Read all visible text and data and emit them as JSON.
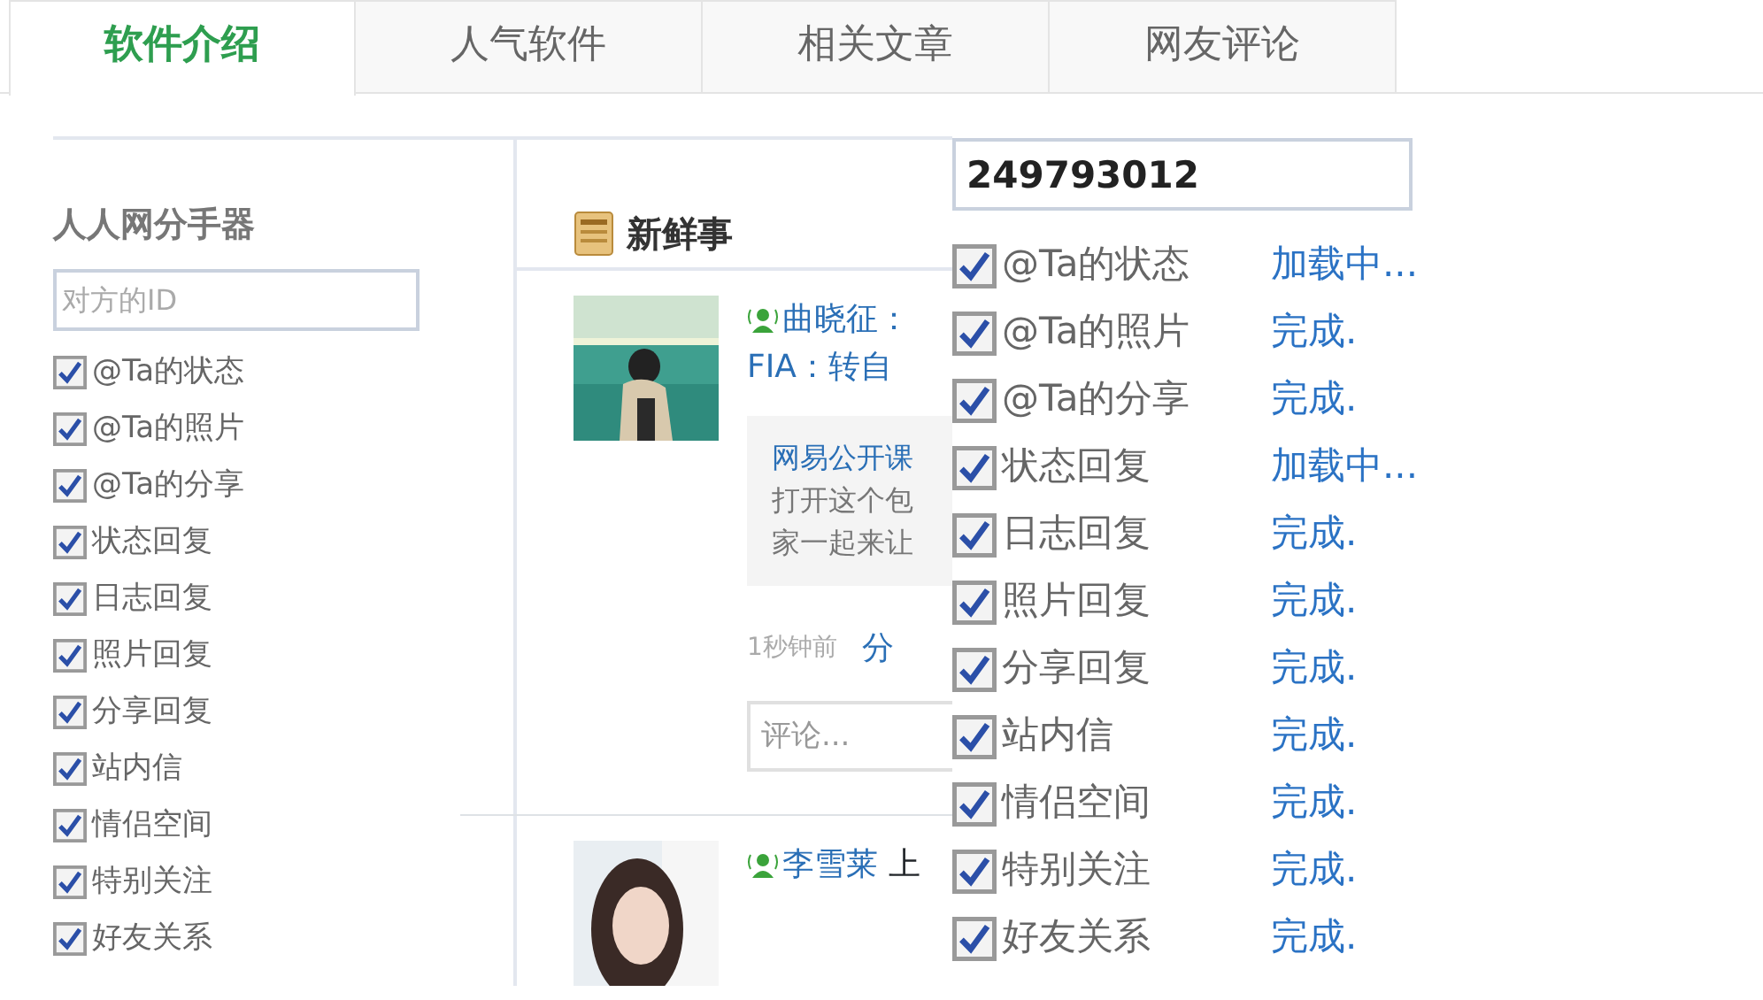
{
  "tabs": [
    {
      "label": "软件介绍",
      "selected": true
    },
    {
      "label": "人气软件",
      "selected": false
    },
    {
      "label": "相关文章",
      "selected": false
    },
    {
      "label": "网友评论",
      "selected": false
    }
  ],
  "left_panel": {
    "title": "人人网分手器",
    "id_field": {
      "placeholder": "对方的ID"
    },
    "options": [
      {
        "label": "@Ta的状态",
        "checked": true
      },
      {
        "label": "@Ta的照片",
        "checked": true
      },
      {
        "label": "@Ta的分享",
        "checked": true
      },
      {
        "label": "状态回复",
        "checked": true
      },
      {
        "label": "日志回复",
        "checked": true
      },
      {
        "label": "照片回复",
        "checked": true
      },
      {
        "label": "分享回复",
        "checked": true
      },
      {
        "label": "站内信",
        "checked": true
      },
      {
        "label": "情侣空间",
        "checked": true
      },
      {
        "label": "特别关注",
        "checked": true
      },
      {
        "label": "好友关系",
        "checked": true
      }
    ]
  },
  "feed": {
    "title": "新鲜事",
    "posts": [
      {
        "author": "曲晓征：",
        "text": "FIA：转自",
        "shared": {
          "title": "网易公开课",
          "lines": [
            "打开这个包",
            "家一起来让"
          ]
        },
        "time": "1秒钟前",
        "action": "分",
        "comment": {
          "placeholder": "评论..."
        }
      },
      {
        "author": "李雪莱",
        "text": "上"
      }
    ]
  },
  "tool_panel": {
    "id_field": {
      "value": "249793012"
    },
    "options": [
      {
        "label": "@Ta的状态",
        "checked": true,
        "status": "加载中..."
      },
      {
        "label": "@Ta的照片",
        "checked": true,
        "status": "完成."
      },
      {
        "label": "@Ta的分享",
        "checked": true,
        "status": "完成."
      },
      {
        "label": "状态回复",
        "checked": true,
        "status": "加载中..."
      },
      {
        "label": "日志回复",
        "checked": true,
        "status": "完成."
      },
      {
        "label": "照片回复",
        "checked": true,
        "status": "完成."
      },
      {
        "label": "分享回复",
        "checked": true,
        "status": "完成."
      },
      {
        "label": "站内信",
        "checked": true,
        "status": "完成."
      },
      {
        "label": "情侣空间",
        "checked": true,
        "status": "完成."
      },
      {
        "label": "特别关注",
        "checked": true,
        "status": "完成."
      },
      {
        "label": "好友关系",
        "checked": true,
        "status": "完成."
      }
    ]
  }
}
